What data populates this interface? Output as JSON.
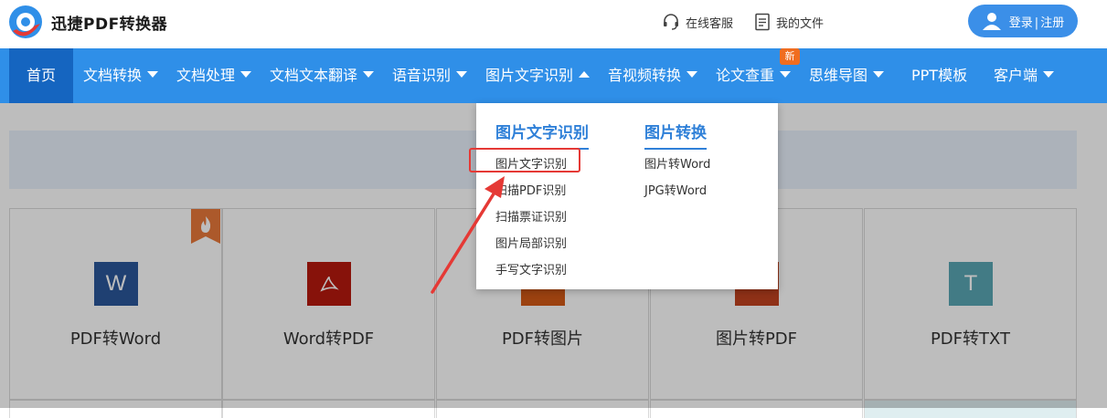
{
  "brand": {
    "name": "迅捷PDF转换器"
  },
  "header": {
    "support_label": "在线客服",
    "files_label": "我的文件",
    "login_label": "登录",
    "register_label": "注册",
    "login_sep": "|"
  },
  "nav": {
    "items": [
      {
        "label": "首页"
      },
      {
        "label": "文档转换"
      },
      {
        "label": "文档处理"
      },
      {
        "label": "文档文本翻译"
      },
      {
        "label": "语音识别"
      },
      {
        "label": "图片文字识别"
      },
      {
        "label": "音视频转换"
      },
      {
        "label": "论文查重"
      },
      {
        "label": "思维导图"
      },
      {
        "label": "PPT模板"
      },
      {
        "label": "客户端"
      }
    ],
    "new_badge": "新"
  },
  "dropdown": {
    "col1": {
      "title": "图片文字识别",
      "items": [
        "图片文字识别",
        "扫描PDF识别",
        "扫描票证识别",
        "图片局部识别",
        "手写文字识别"
      ]
    },
    "col2": {
      "title": "图片转换",
      "items": [
        "图片转Word",
        "JPG转Word"
      ]
    }
  },
  "cards": [
    {
      "label": "PDF转Word",
      "icon_text": "W",
      "color": "#2b579a"
    },
    {
      "label": "Word转PDF",
      "icon_text": "",
      "color": "#b7190e"
    },
    {
      "label": "PDF转图片",
      "icon_text": "",
      "color": "#d35a16"
    },
    {
      "label": "图片转PDF",
      "icon_text": "",
      "color": "#c1431f"
    },
    {
      "label": "PDF转TXT",
      "icon_text": "T",
      "color": "#5aa6b4"
    }
  ],
  "colors": {
    "nav_bg": "#2f8fe8",
    "accent": "#2f80d8",
    "highlight": "#e53935"
  }
}
